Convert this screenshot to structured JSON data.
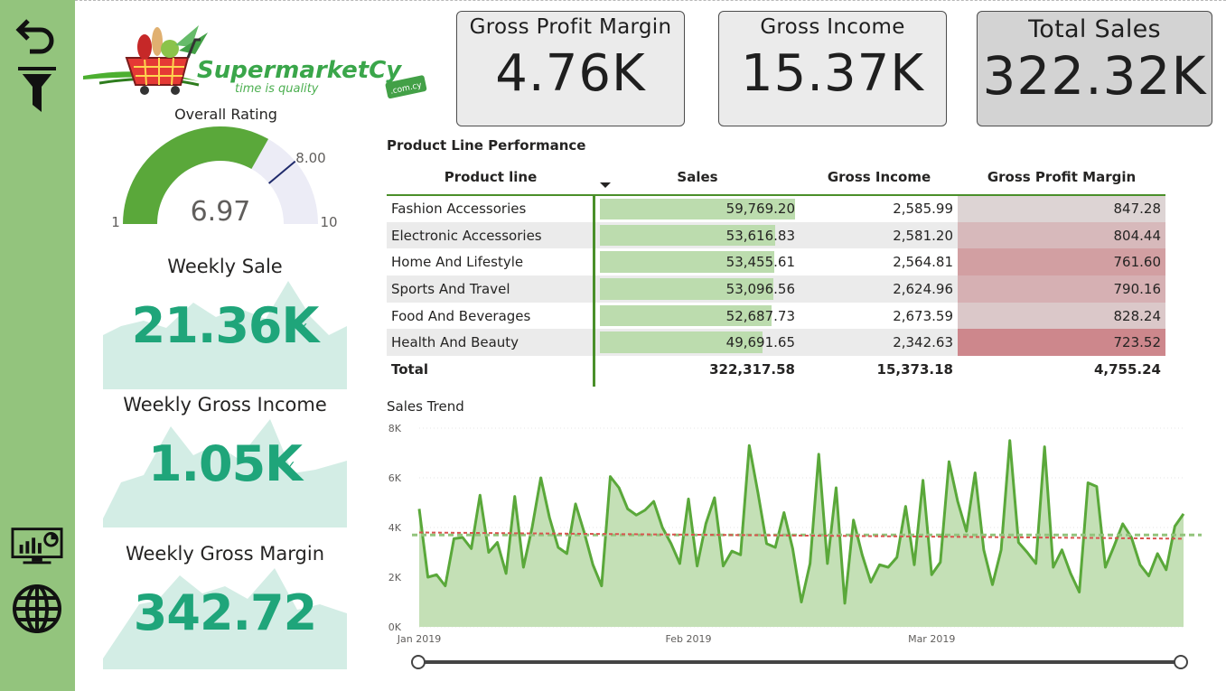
{
  "nav": {
    "back_icon": "back-arrow-icon",
    "filter_icon": "filter-icon",
    "report_icon": "dashboard-icon",
    "web_icon": "globe-icon"
  },
  "logo": {
    "brand": "SupermarketCy",
    "tagline": "time is quality",
    "domain_badge": ".com.cy"
  },
  "kpis": {
    "gross_profit_margin": {
      "label": "Gross Profit Margin",
      "value": "4.76K"
    },
    "gross_income": {
      "label": "Gross Income",
      "value": "15.37K"
    },
    "total_sales": {
      "label": "Total Sales",
      "value": "322.32K"
    }
  },
  "gauge": {
    "title": "Overall Rating",
    "value": 6.97,
    "value_label": "6.97",
    "min": 1,
    "min_label": "1",
    "max": 10,
    "max_label": "10",
    "target": 8.0,
    "target_label": "8.00",
    "fill_color": "#5aa83a",
    "track_color": "#ececf6"
  },
  "weekly": {
    "sale": {
      "title": "Weekly Sale",
      "value": "21.36K"
    },
    "gross_income": {
      "title": "Weekly Gross Income",
      "value": "1.05K"
    },
    "gross_margin": {
      "title": "Weekly Gross Margin",
      "value": "342.72"
    }
  },
  "table": {
    "title": "Product Line Performance",
    "headers": [
      "Product line",
      "Sales",
      "Gross Income",
      "Gross Profit Margin"
    ],
    "rows": [
      {
        "product": "Fashion Accessories",
        "sales": "59,769.20",
        "sales_value": 59769.2,
        "income": "2,585.99",
        "margin": "847.28",
        "margin_value": 847.28
      },
      {
        "product": "Electronic Accessories",
        "sales": "53,616.83",
        "sales_value": 53616.83,
        "income": "2,581.20",
        "margin": "804.44",
        "margin_value": 804.44
      },
      {
        "product": "Home And Lifestyle",
        "sales": "53,455.61",
        "sales_value": 53455.61,
        "income": "2,564.81",
        "margin": "761.60",
        "margin_value": 761.6
      },
      {
        "product": "Sports And Travel",
        "sales": "53,096.56",
        "sales_value": 53096.56,
        "income": "2,624.96",
        "margin": "790.16",
        "margin_value": 790.16
      },
      {
        "product": "Food And Beverages",
        "sales": "52,687.73",
        "sales_value": 52687.73,
        "income": "2,673.59",
        "margin": "828.24",
        "margin_value": 828.24
      },
      {
        "product": "Health And Beauty",
        "sales": "49,691.65",
        "sales_value": 49691.65,
        "income": "2,342.63",
        "margin": "723.52",
        "margin_value": 723.52
      }
    ],
    "total": {
      "label": "Total",
      "sales": "322,317.58",
      "income": "15,373.18",
      "margin": "4,755.24"
    },
    "bar_color": "#bcdcae"
  },
  "chart_data": {
    "type": "area",
    "title": "Sales Trend",
    "xlabel": "",
    "ylabel": "",
    "x_tick_labels": [
      "Jan 2019",
      "Feb 2019",
      "Mar 2019"
    ],
    "y_tick_labels": [
      "0K",
      "2K",
      "4K",
      "6K",
      "8K"
    ],
    "ylim": [
      0,
      8000
    ],
    "series": [
      {
        "values": [
          4750,
          2000,
          2100,
          1650,
          3550,
          3600,
          3150,
          5300,
          3000,
          3400,
          2150,
          5250,
          2400,
          4000,
          6000,
          4400,
          3200,
          2950,
          4950,
          3800,
          2500,
          1650,
          6050,
          5600,
          4750,
          4500,
          4700,
          5050,
          4000,
          3350,
          2550,
          5150,
          2450,
          4150,
          5200,
          2450,
          3050,
          2900,
          7300,
          5400,
          3350,
          3200,
          4600,
          3150,
          1000,
          2550,
          6950,
          2550,
          5600,
          950,
          4300,
          2900,
          1800,
          2500,
          2400,
          2800,
          4850,
          2500,
          5900,
          2100,
          2600,
          6650,
          5050,
          3850,
          6200,
          3100,
          1700,
          3100,
          7500,
          3400,
          3000,
          2550,
          7250,
          2400,
          3100,
          2150,
          1400,
          5800,
          5650,
          2400,
          3250,
          4150,
          3600,
          2500,
          2050,
          2950,
          2300,
          4050,
          4550
        ]
      }
    ],
    "average_line": 3700,
    "trend_line": [
      3800,
      3550
    ],
    "line_color": "#5aa83a",
    "area_color": "#c4e0b6",
    "average_color": "#93c47d",
    "trend_color": "#d9534f",
    "grid": true
  }
}
